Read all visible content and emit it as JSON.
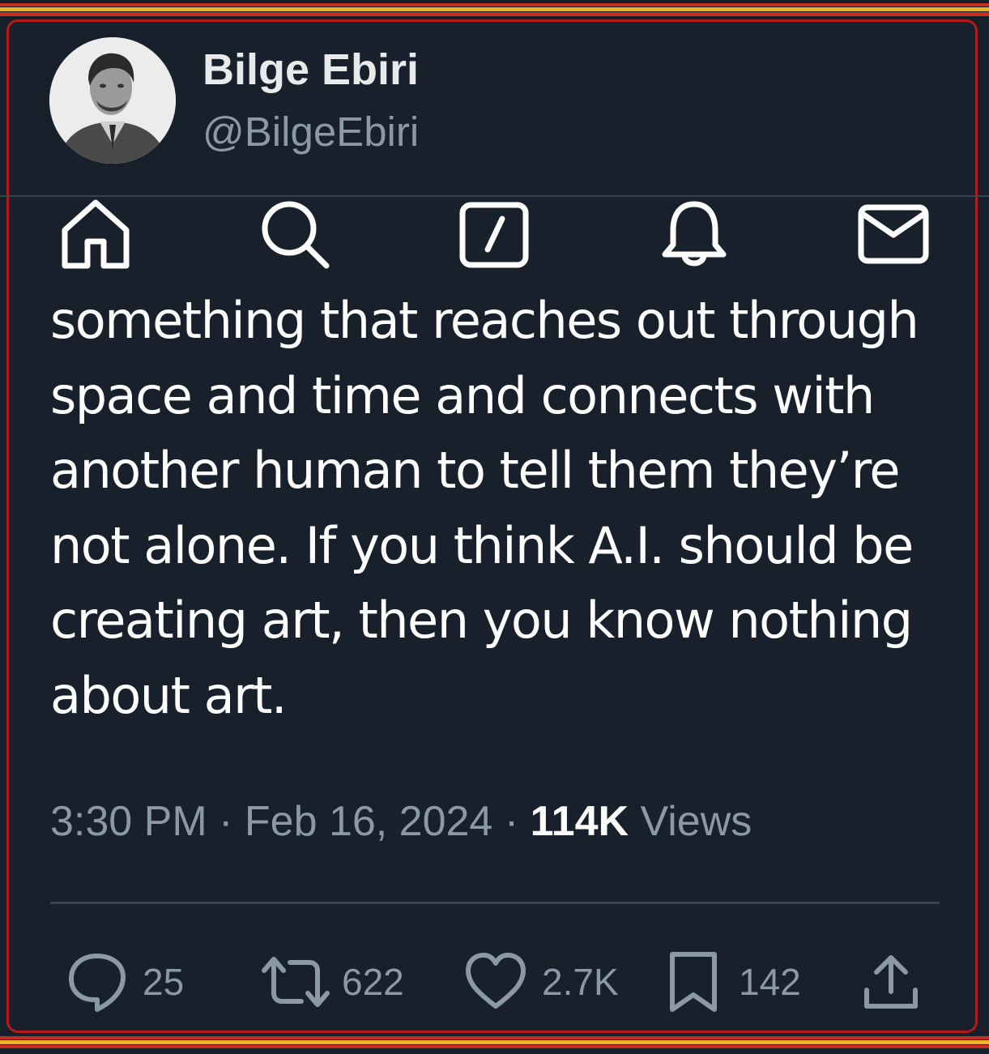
{
  "author": {
    "display_name": "Bilge Ebiri",
    "handle": "@BilgeEbiri"
  },
  "nav": {
    "icons": [
      "home-icon",
      "search-icon",
      "compose-icon",
      "notifications-icon",
      "messages-icon"
    ]
  },
  "tweet": {
    "lines": [
      "something that reaches out through",
      "space and time and connects with",
      "another human to tell them they’re",
      "not alone. If you think A.I. should be",
      "creating art, then you know nothing",
      "about art."
    ],
    "time": "3:30 PM",
    "separator": "·",
    "date": "Feb 16, 2024",
    "views_count": "114K",
    "views_label": "Views"
  },
  "actions": {
    "replies": "25",
    "retweets": "622",
    "likes": "2.7K",
    "bookmarks": "142"
  },
  "colors": {
    "background": "#15202b",
    "text_primary": "#ffffff",
    "text_secondary": "#8b98a5",
    "divider": "#38444d",
    "border": "#b41a1a"
  }
}
